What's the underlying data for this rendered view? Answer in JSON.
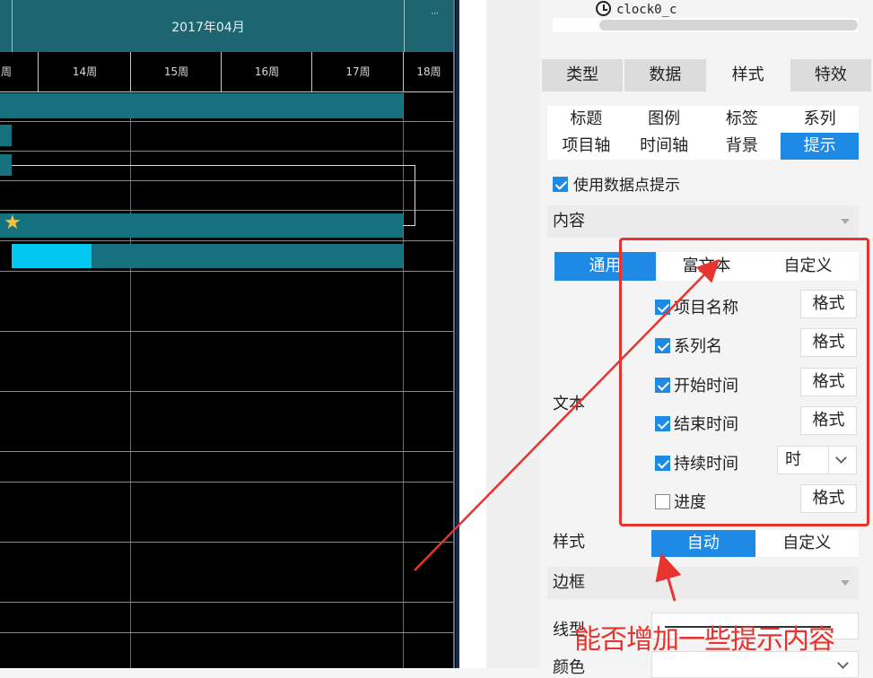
{
  "gantt": {
    "month": "2017年04月",
    "more": "···",
    "days": [
      "周",
      "14周",
      "15周",
      "16周",
      "17周",
      "18周"
    ]
  },
  "panel": {
    "node_label": "clock0_c",
    "main_tabs": [
      "类型",
      "数据",
      "样式",
      "特效"
    ],
    "style_tabs_row1": [
      "标题",
      "图例",
      "标签",
      "系列"
    ],
    "style_tabs_row2": [
      "项目轴",
      "时间轴",
      "背景",
      "提示"
    ],
    "use_tip_label": "使用数据点提示",
    "content_section": "内容",
    "content_tabs": [
      "通用",
      "富文本",
      "自定义"
    ],
    "text_label": "文本",
    "items": [
      {
        "label": "项目名称",
        "checked": true,
        "control": "格式"
      },
      {
        "label": "系列名",
        "checked": true,
        "control": "格式"
      },
      {
        "label": "开始时间",
        "checked": true,
        "control": "格式"
      },
      {
        "label": "结束时间",
        "checked": true,
        "control": "格式"
      },
      {
        "label": "持续时间",
        "checked": true,
        "control": "时"
      },
      {
        "label": "进度",
        "checked": false,
        "control": "格式"
      }
    ],
    "style_label": "样式",
    "style_mode_tabs": [
      "自动",
      "自定义"
    ],
    "border_section": "边框",
    "line_type_label": "线型",
    "color_label": "颜色"
  },
  "annotation": {
    "text": "能否增加一些提示内容",
    "color": "#e8332e"
  },
  "colors": {
    "accent": "#1e8ae6",
    "gantt_bar": "#16717f",
    "gantt_progress": "#00c8f0",
    "gantt_header": "#1d6570"
  }
}
